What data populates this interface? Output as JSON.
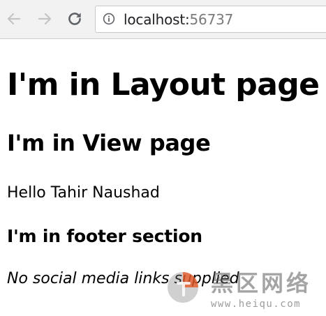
{
  "browser": {
    "url_host": "localhost:",
    "url_port": "56737",
    "icons": {
      "back": "arrow-left",
      "forward": "arrow-right",
      "reload": "reload",
      "info": "info-circle"
    }
  },
  "page": {
    "layout_heading": "I'm in Layout page",
    "view_heading": "I'm in View page",
    "greeting": "Hello Tahir Naushad",
    "footer_heading": "I'm in footer section",
    "footer_note": "No social media links supplied"
  },
  "watermark": {
    "brand": "黑区网络",
    "url": "www.heiqu.com",
    "colors": {
      "logo": "#e8541e"
    }
  }
}
